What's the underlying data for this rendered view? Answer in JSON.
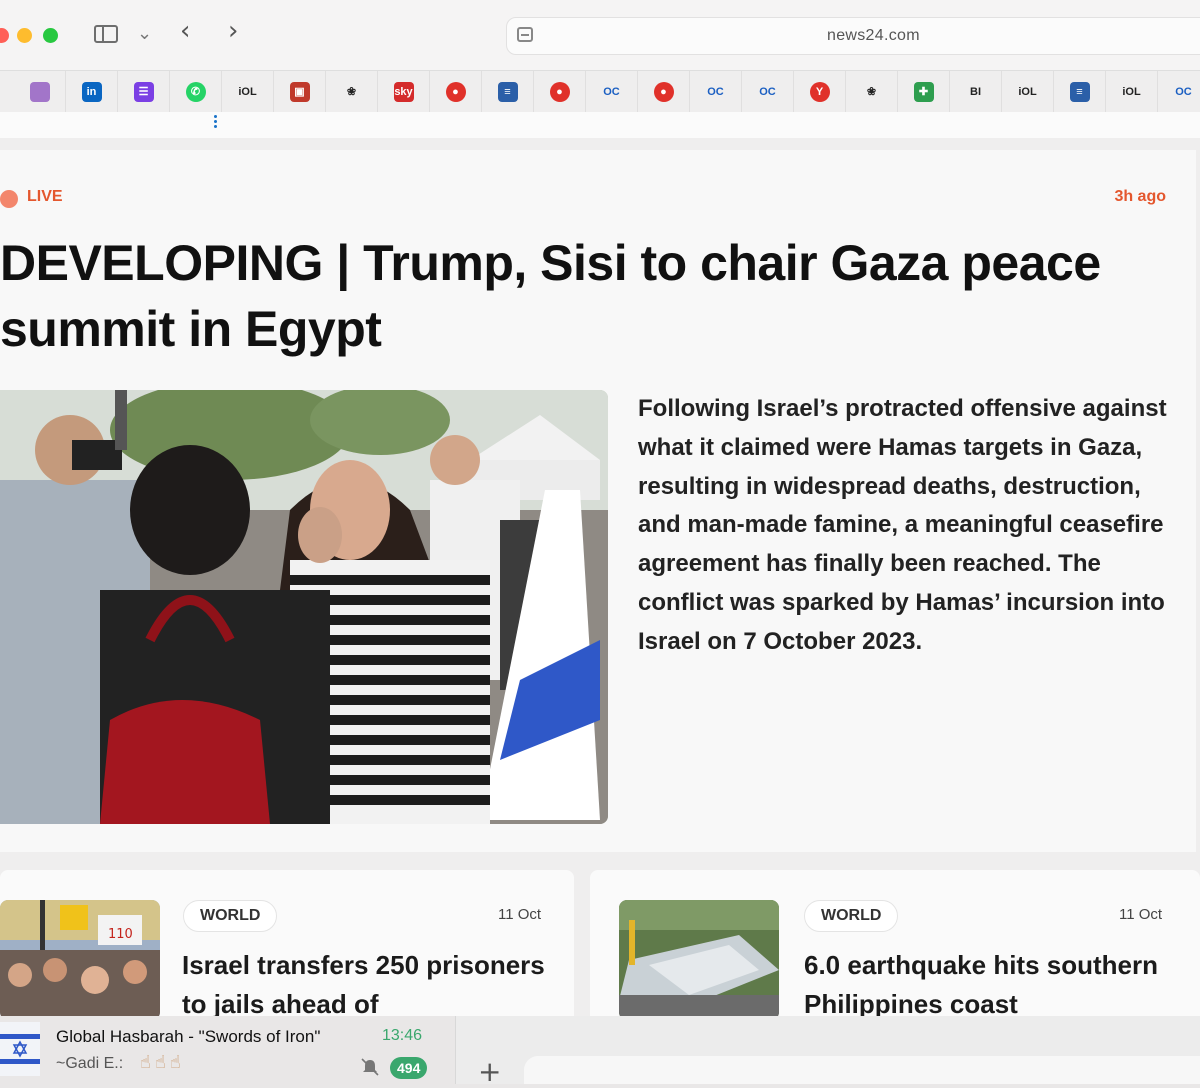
{
  "browser": {
    "url": "news24.com"
  },
  "favorites": [
    {
      "icon": "bookmark-arrow-icon",
      "glyph": "",
      "color": "#a275c9"
    },
    {
      "icon": "linkedin-icon",
      "glyph": "in",
      "color": "#0a66c2"
    },
    {
      "icon": "purple-app-icon",
      "glyph": "☰",
      "color": "#7b3fe4"
    },
    {
      "icon": "whatsapp-icon",
      "glyph": "✆",
      "color": "#25d366"
    },
    {
      "icon": "iol-icon",
      "glyph": "iOL",
      "color": "plain"
    },
    {
      "icon": "elephant-icon",
      "glyph": "▣",
      "color": "#c0392b"
    },
    {
      "icon": "globe-icon",
      "glyph": "❀",
      "color": "plain"
    },
    {
      "icon": "sky-news-icon",
      "glyph": "sky",
      "color": "#d42b2b"
    },
    {
      "icon": "red-news-icon",
      "glyph": "●",
      "color": "#e0312a"
    },
    {
      "icon": "flag-icon",
      "glyph": "≡",
      "color": "#2b5fa8"
    },
    {
      "icon": "red-news-icon",
      "glyph": "●",
      "color": "#e0312a"
    },
    {
      "icon": "oc-icon",
      "glyph": "OC",
      "color": "plain-blue"
    },
    {
      "icon": "red-news-icon",
      "glyph": "●",
      "color": "#e0312a"
    },
    {
      "icon": "oc-icon",
      "glyph": "OC",
      "color": "plain-blue"
    },
    {
      "icon": "oc-icon",
      "glyph": "OC",
      "color": "plain-blue"
    },
    {
      "icon": "y-icon",
      "glyph": "Y",
      "color": "#e0312a"
    },
    {
      "icon": "badge-icon",
      "glyph": "❀",
      "color": "plain"
    },
    {
      "icon": "green-cross-icon",
      "glyph": "✚",
      "color": "#2e9e4f"
    },
    {
      "icon": "bi-icon",
      "glyph": "BI",
      "color": "plain"
    },
    {
      "icon": "iol-icon",
      "glyph": "iOL",
      "color": "plain"
    },
    {
      "icon": "flag-icon",
      "glyph": "≡",
      "color": "#2b5fa8"
    },
    {
      "icon": "iol-icon",
      "glyph": "iOL",
      "color": "plain"
    },
    {
      "icon": "oc-icon",
      "glyph": "OC",
      "color": "plain-blue"
    }
  ],
  "hero": {
    "live_label": "LIVE",
    "time_ago": "3h ago",
    "headline": "DEVELOPING | Trump, Sisi to chair Gaza peace summit in Egypt",
    "summary": "Following Israel’s protracted offensive against what it claimed were Hamas targets in Gaza, resulting in widespread deaths, destruction, and man-made famine, a meaningful ceasefire agreement has finally been reached. The conflict was sparked by Hamas’ incursion into Israel on 7 October 2023."
  },
  "cards": [
    {
      "tag": "WORLD",
      "date": "11 Oct",
      "title": "Israel transfers 250 prisoners to jails ahead of"
    },
    {
      "tag": "WORLD",
      "date": "11 Oct",
      "title": "6.0 earthquake hits southern Philippines coast"
    }
  ],
  "chat": {
    "name": "Global Hasbarah - \"Swords of Iron\"",
    "time": "13:46",
    "sender": "~Gadi E.:",
    "unread": "494"
  },
  "colors": {
    "accent": "#e4572e",
    "live_dot": "#f3866c",
    "chat_green": "#3aa76d"
  }
}
